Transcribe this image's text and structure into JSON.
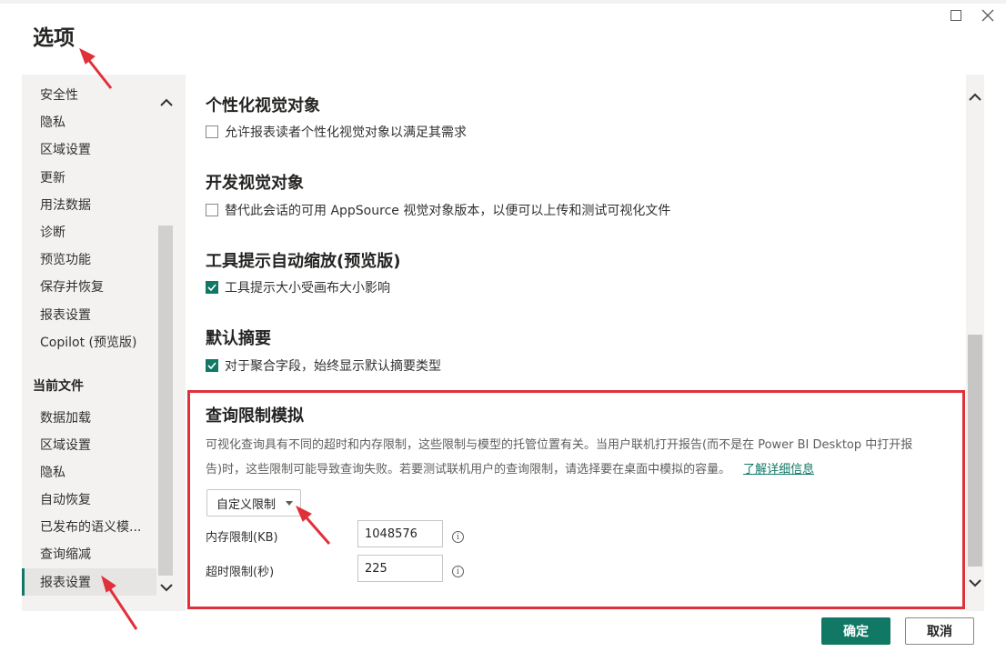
{
  "dialog": {
    "title": "选项",
    "icons": {
      "maximize": "maximize-icon",
      "close": "close-icon"
    }
  },
  "sidebar": {
    "global_items": [
      "安全性",
      "隐私",
      "区域设置",
      "更新",
      "用法数据",
      "诊断",
      "预览功能",
      "保存并恢复",
      "报表设置",
      "Copilot (预览版)"
    ],
    "current_file_heading": "当前文件",
    "file_items": [
      "数据加载",
      "区域设置",
      "隐私",
      "自动恢复",
      "已发布的语义模...",
      "查询缩减",
      "报表设置"
    ],
    "active_item": "报表设置"
  },
  "sections": [
    {
      "title": "个性化视觉对象",
      "option": "允许报表读者个性化视觉对象以满足其需求",
      "checked": false
    },
    {
      "title": "开发视觉对象",
      "option": "替代此会话的可用 AppSource 视觉对象版本，以便可以上传和测试可视化文件",
      "checked": false
    },
    {
      "title": "工具提示自动缩放(预览版)",
      "option": "工具提示大小受画布大小影响",
      "checked": true
    },
    {
      "title": "默认摘要",
      "option": "对于聚合字段，始终显示默认摘要类型",
      "checked": true
    }
  ],
  "query_limit": {
    "title": "查询限制模拟",
    "description_line1": "可视化查询具有不同的超时和内存限制，这些限制与模型的托管位置有关。当用户联机打开报告(而不是在 Power BI Desktop 中打开报",
    "description_line2": "告)时，这些限制可能导致查询失败。若要测试联机用户的查询限制，请选择要在桌面中模拟的容量。",
    "learn_more": "了解详细信息",
    "dropdown_value": "自定义限制",
    "memory_label": "内存限制(KB)",
    "memory_value": "1048576",
    "timeout_label": "超时限制(秒)",
    "timeout_value": "225",
    "info_glyph": "i"
  },
  "buttons": {
    "ok": "确定",
    "cancel": "取消"
  },
  "colors": {
    "accent": "#117865",
    "highlight": "#e0303a",
    "annotation_arrow": "#e0303a"
  }
}
